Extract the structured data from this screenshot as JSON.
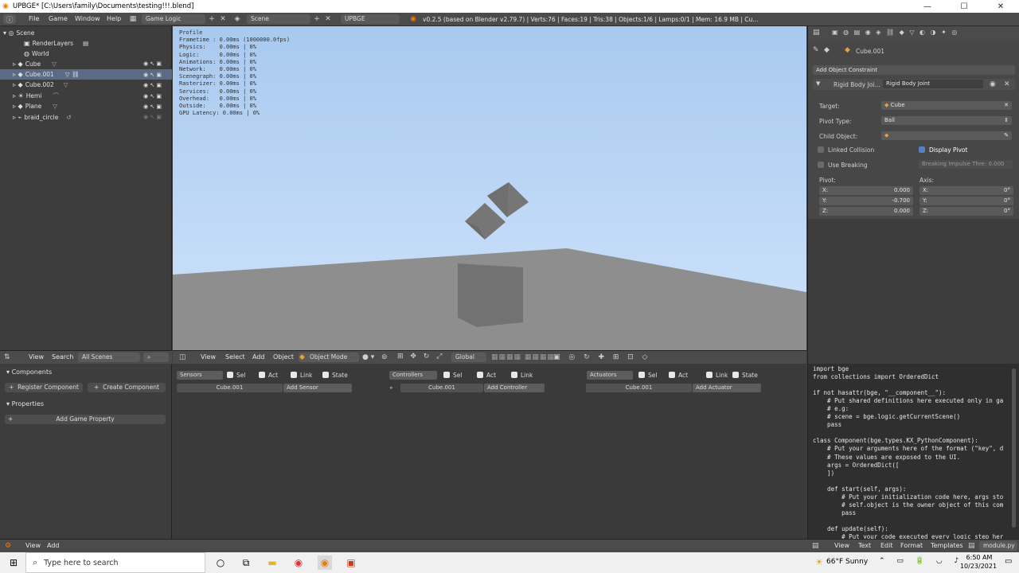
{
  "window": {
    "title": "UPBGE* [C:\\Users\\family\\Documents\\testing!!!.blend]"
  },
  "topbar": {
    "menus": [
      "File",
      "Game",
      "Window",
      "Help"
    ],
    "layout": "Game Logic",
    "scene": "Scene",
    "engine": "UPBGE",
    "stats": "v0.2.5 (based on Blender v2.79.7) | Verts:76 | Faces:19 | Tris:38 | Objects:1/6 | Lamps:0/1 | Mem: 16.9 MB | Cu..."
  },
  "outliner": {
    "items": [
      {
        "label": "Scene",
        "icon": "scene-icon"
      },
      {
        "label": "RenderLayers",
        "icon": "render-layers-icon"
      },
      {
        "label": "World",
        "icon": "world-icon"
      },
      {
        "label": "Cube",
        "icon": "mesh-object-icon"
      },
      {
        "label": "Cube.001",
        "icon": "mesh-object-icon"
      },
      {
        "label": "Cube.002",
        "icon": "mesh-object-icon"
      },
      {
        "label": "Hemi",
        "icon": "lamp-icon"
      },
      {
        "label": "Plane",
        "icon": "mesh-object-icon"
      },
      {
        "label": "braid_circle",
        "icon": "curve-icon"
      }
    ]
  },
  "profile": {
    "title": "Profile",
    "rows": [
      "Frametime : 0.00ms (1000000.0fps)",
      "Physics:    0.00ms | 0%",
      "Logic:      0.00ms | 0%",
      "Animations: 0.00ms | 0%",
      "Network:    0.00ms | 0%",
      "Scenegraph: 0.00ms | 0%",
      "Rasterizer: 0.00ms | 0%",
      "Services:   0.00ms | 0%",
      "Overhead:   0.00ms | 0%",
      "Outside:    0.00ms | 0%",
      "GPU Latency: 0.00ms | 0%"
    ]
  },
  "properties": {
    "object_name": "Cube.001",
    "add_constraint": "Add Object Constraint",
    "constraint_short": "Rigid Body Joi...",
    "constraint_name": "Rigid Body Joint",
    "target_label": "Target:",
    "target_value": "Cube",
    "pivot_type_label": "Pivot Type:",
    "pivot_type_value": "Ball",
    "child_label": "Child Object:",
    "linked_collision": "Linked Collision",
    "display_pivot": "Display Pivot",
    "use_breaking": "Use Breaking",
    "breaking_threshold": "Breaking Impulse Thre: 0.000",
    "pivot_label": "Pivot:",
    "axis_label": "Axis:",
    "pivot": [
      {
        "k": "X:",
        "v": "0.000"
      },
      {
        "k": "Y:",
        "v": "-0.700"
      },
      {
        "k": "Z:",
        "v": "0.000"
      }
    ],
    "axis": [
      {
        "k": "X:",
        "v": "0°"
      },
      {
        "k": "Y:",
        "v": "0°"
      },
      {
        "k": "Z:",
        "v": "0°"
      }
    ]
  },
  "left_header": {
    "view": "View",
    "search": "Search",
    "filter": "All Scenes"
  },
  "viewport_header": {
    "view": "View",
    "select": "Select",
    "add": "Add",
    "object": "Object",
    "mode": "Object Mode",
    "orientation": "Global"
  },
  "components": {
    "title": "Components",
    "register": "Register Component",
    "create": "Create Component",
    "properties_title": "Properties",
    "add_property": "Add Game Property"
  },
  "logic": {
    "sel": "Sel",
    "act": "Act",
    "link": "Link",
    "state": "State",
    "sensors": "Sensors",
    "controllers": "Controllers",
    "actuators": "Actuators",
    "object": "Cube.001",
    "add_sensor": "Add Sensor",
    "add_controller": "Add Controller",
    "add_actuator": "Add Actuator"
  },
  "code": "import bge\nfrom collections import OrderedDict\n\nif not hasattr(bge, \"__component__\"):\n    # Put shared definitions here executed only in ga\n    # e.g:\n    # scene = bge.logic.getCurrentScene()\n    pass\n\nclass Component(bge.types.KX_PythonComponent):\n    # Put your arguments here of the format (\"key\", d\n    # These values are exposed to the UI.\n    args = OrderedDict([\n    ])\n\n    def start(self, args):\n        # Put your initialization code here, args sto\n        # self.object is the owner object of this com\n        pass\n\n    def update(self):\n        # Put your code executed every logic step her",
  "bottom_bar": {
    "view": "View",
    "add": "Add"
  },
  "text_bar": {
    "view": "View",
    "text": "Text",
    "edit": "Edit",
    "format": "Format",
    "templates": "Templates",
    "file": "module.py"
  },
  "taskbar": {
    "search_placeholder": "Type here to search",
    "weather": "66°F  Sunny",
    "time": "6:50 AM",
    "date": "10/23/2021"
  }
}
